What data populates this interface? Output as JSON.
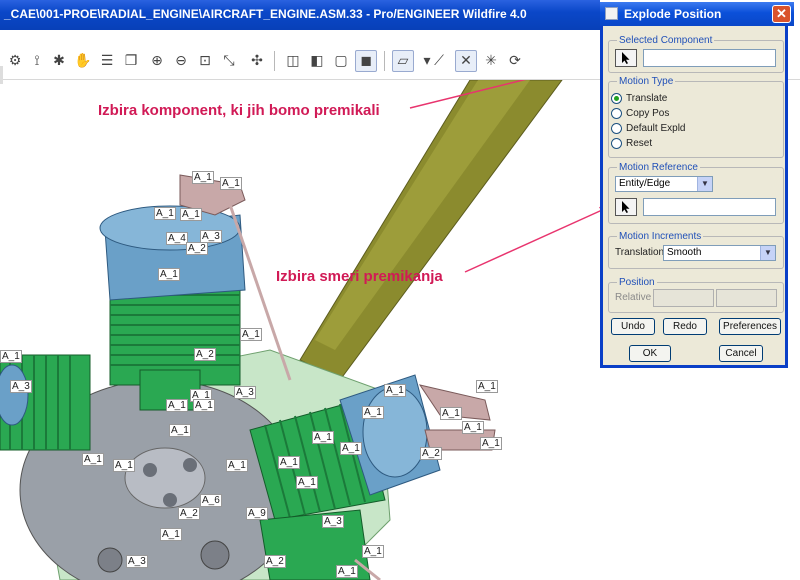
{
  "window": {
    "title": "_CAE\\001-PROE\\RADIAL_ENGINE\\AIRCRAFT_ENGINE.ASM.33 - Pro/ENGINEER Wildfire 4.0"
  },
  "toolbar": {
    "icons": [
      "model-tree-icon",
      "connect-icon",
      "settings-icon",
      "pan-icon",
      "layers-icon",
      "copy-icon",
      "zoom-in-icon",
      "zoom-out-icon",
      "refit-icon",
      "reorient-icon",
      "shaded-box-icon",
      "wireframe-icon",
      "hidden-line-icon",
      "no-hidden-icon",
      "shading-icon",
      "datum-planes-icon",
      "datum-axes-icon",
      "datum-points-icon",
      "coord-systems-icon"
    ]
  },
  "annotations": {
    "select_component": "Izbira komponent, ki jih bomo premikali",
    "motion_direction": "Izbira smeri premikanja"
  },
  "labels": [
    "A_1",
    "A_1",
    "A_1",
    "A_1",
    "A_3",
    "A_4",
    "A_2",
    "A_1",
    "A_1",
    "A_2",
    "A_1",
    "A_3",
    "A_1",
    "A_1",
    "A_3",
    "A_1",
    "A_1",
    "A_1",
    "A_1",
    "A_1",
    "A_1",
    "A_1",
    "A_1",
    "A_2",
    "A_6",
    "A_9",
    "A_2",
    "A_1",
    "A_3",
    "A_1",
    "A_1",
    "A_1",
    "A_1",
    "A_1",
    "A_1",
    "A_1",
    "A_3",
    "A_1",
    "A_2",
    "A_1"
  ],
  "dialog": {
    "title": "Explode Position",
    "close": "✕",
    "selected_component": {
      "legend": "Selected Component",
      "value": ""
    },
    "motion_type": {
      "legend": "Motion Type",
      "options": [
        {
          "label": "Translate",
          "selected": true
        },
        {
          "label": "Copy Pos",
          "selected": false
        },
        {
          "label": "Default Expld",
          "selected": false
        },
        {
          "label": "Reset",
          "selected": false
        }
      ]
    },
    "motion_reference": {
      "legend": "Motion Reference",
      "selected": "Entity/Edge",
      "value": ""
    },
    "motion_increments": {
      "legend": "Motion Increments",
      "label": "Translation",
      "selected": "Smooth"
    },
    "position": {
      "legend": "Position",
      "label": "Relative"
    },
    "buttons": {
      "undo": "Undo",
      "redo": "Redo",
      "preferences": "Preferences",
      "ok": "OK",
      "cancel": "Cancel"
    }
  },
  "colors": {
    "titlebar": "#0a47c8",
    "annotation": "#d11a56",
    "propeller": "#8b8b2e",
    "crankcase": "#c8e6c8",
    "cylinder_fins": "#2aa852",
    "cylinder_head": "#6aa0c8",
    "cover_plate": "#9aa0a8",
    "rocker_arm": "#c8a8a8"
  }
}
